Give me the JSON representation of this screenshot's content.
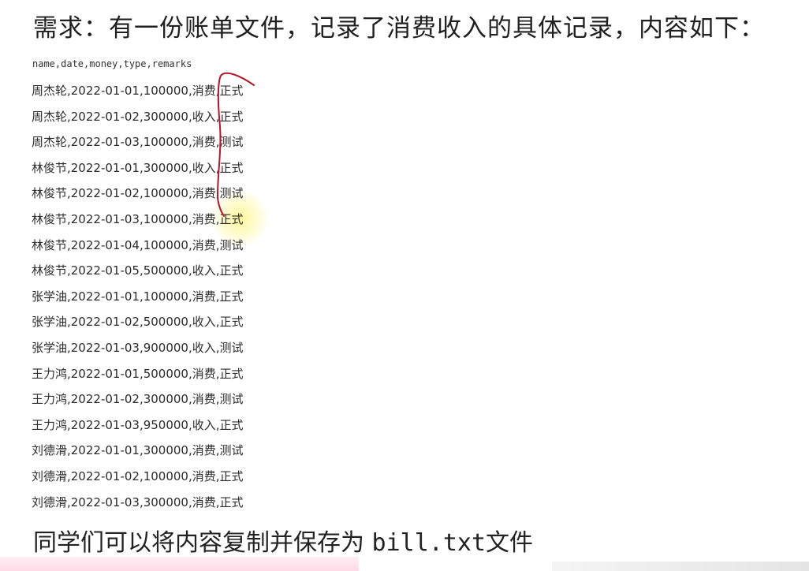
{
  "heading": "需求：有一份账单文件，记录了消费收入的具体记录，内容如下：",
  "csv_header": "name,date,money,type,remarks",
  "records": [
    "周杰轮,2022-01-01,100000,消费,正式",
    "周杰轮,2022-01-02,300000,收入,正式",
    "周杰轮,2022-01-03,100000,消费,测试",
    "林俊节,2022-01-01,300000,收入,正式",
    "林俊节,2022-01-02,100000,消费,测试",
    "林俊节,2022-01-03,100000,消费,正式",
    "林俊节,2022-01-04,100000,消费,测试",
    "林俊节,2022-01-05,500000,收入,正式",
    "张学油,2022-01-01,100000,消费,正式",
    "张学油,2022-01-02,500000,收入,正式",
    "张学油,2022-01-03,900000,收入,测试",
    "王力鸿,2022-01-01,500000,消费,正式",
    "王力鸿,2022-01-02,300000,消费,测试",
    "王力鸿,2022-01-03,950000,收入,正式",
    "刘德滑,2022-01-01,300000,消费,测试",
    "刘德滑,2022-01-02,100000,消费,正式",
    "刘德滑,2022-01-03,300000,消费,正式"
  ],
  "footer": {
    "prefix": "同学们可以将内容复制并保存为 ",
    "filename": "bill.txt",
    "suffix": "文件"
  },
  "colors": {
    "annotation_stroke": "#b5172a",
    "highlight": "#fff478"
  }
}
